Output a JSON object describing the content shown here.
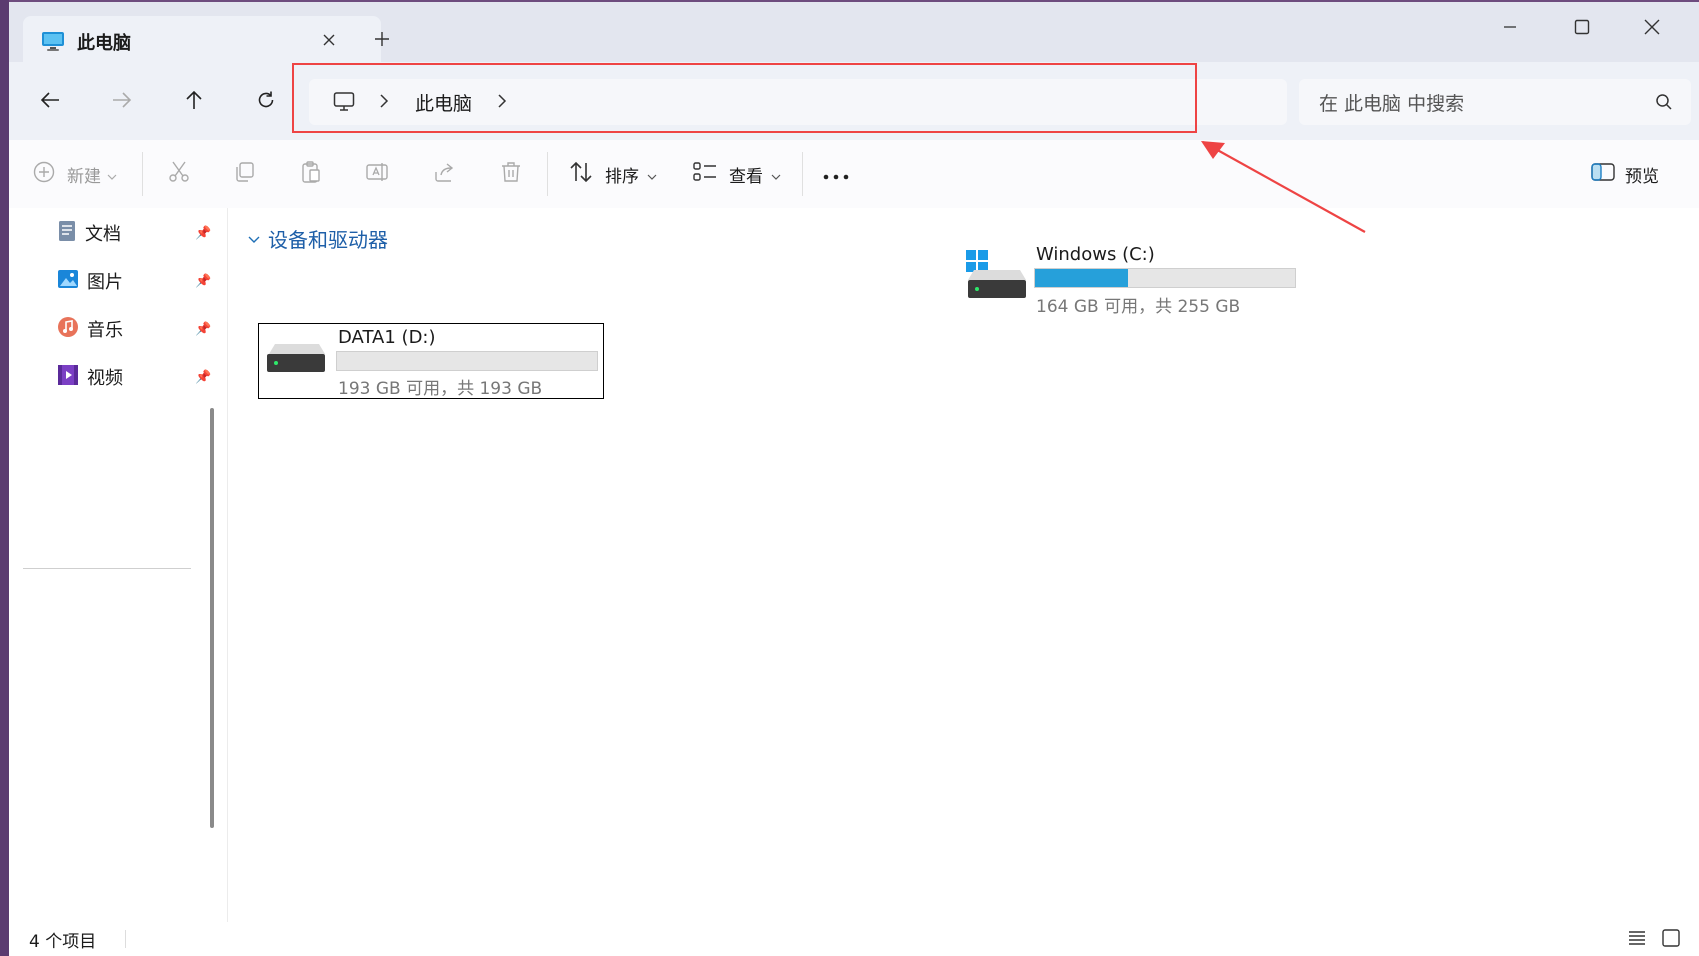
{
  "tab": {
    "title": "此电脑"
  },
  "address": {
    "breadcrumb": [
      "此电脑"
    ]
  },
  "search": {
    "placeholder": "在 此电脑 中搜索"
  },
  "toolbar": {
    "new_label": "新建",
    "sort_label": "排序",
    "view_label": "查看",
    "preview_label": "预览"
  },
  "sidebar": {
    "items": [
      {
        "label": "文档",
        "icon": "documents-icon"
      },
      {
        "label": "图片",
        "icon": "pictures-icon"
      },
      {
        "label": "音乐",
        "icon": "music-icon"
      },
      {
        "label": "视频",
        "icon": "videos-icon"
      }
    ]
  },
  "section": {
    "title": "设备和驱动器"
  },
  "drives": [
    {
      "name": "Windows (C:)",
      "summary": "164 GB 可用，共 255 GB",
      "used_fraction": 0.357
    },
    {
      "name": "DATA1 (D:)",
      "summary": "193 GB 可用，共 193 GB",
      "used_fraction": 0.0
    }
  ],
  "status": {
    "item_count": "4 个项目"
  },
  "colors": {
    "accent": "#26a0da",
    "annotation": "#ee4444",
    "selection_border": "#000000"
  }
}
